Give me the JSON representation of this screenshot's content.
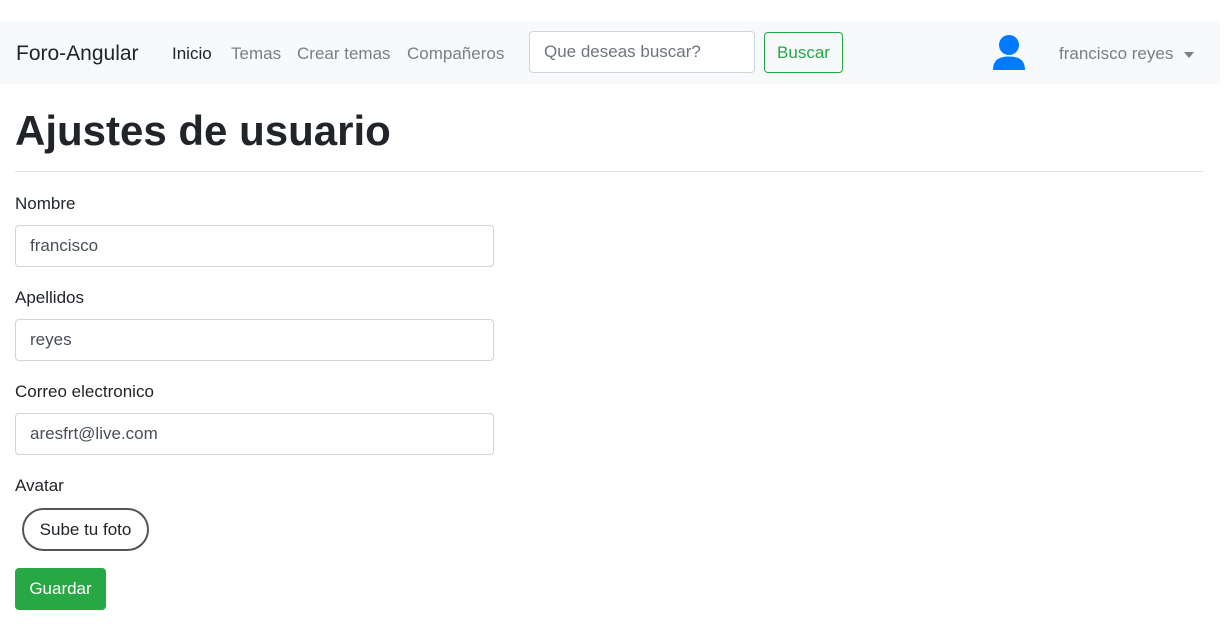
{
  "navbar": {
    "brand": "Foro-Angular",
    "links": [
      {
        "label": "Inicio",
        "active": true
      },
      {
        "label": "Temas",
        "active": false
      },
      {
        "label": "Crear temas",
        "active": false
      },
      {
        "label": "Compañeros",
        "active": false
      }
    ],
    "search": {
      "placeholder": "Que deseas buscar?",
      "value": ""
    },
    "search_button": "Buscar",
    "avatar_icon": "user-icon",
    "user_name": "francisco reyes"
  },
  "page": {
    "title": "Ajustes de usuario"
  },
  "form": {
    "nombre": {
      "label": "Nombre",
      "value": "francisco"
    },
    "apellidos": {
      "label": "Apellidos",
      "value": "reyes"
    },
    "correo": {
      "label": "Correo electronico",
      "value": "aresfrt@live.com"
    },
    "avatar": {
      "label": "Avatar",
      "upload_button": "Sube tu foto"
    },
    "save_button": "Guardar"
  },
  "colors": {
    "accent_green": "#28a745",
    "avatar_blue": "#007bff",
    "navbar_bg": "#f8f9fa"
  }
}
